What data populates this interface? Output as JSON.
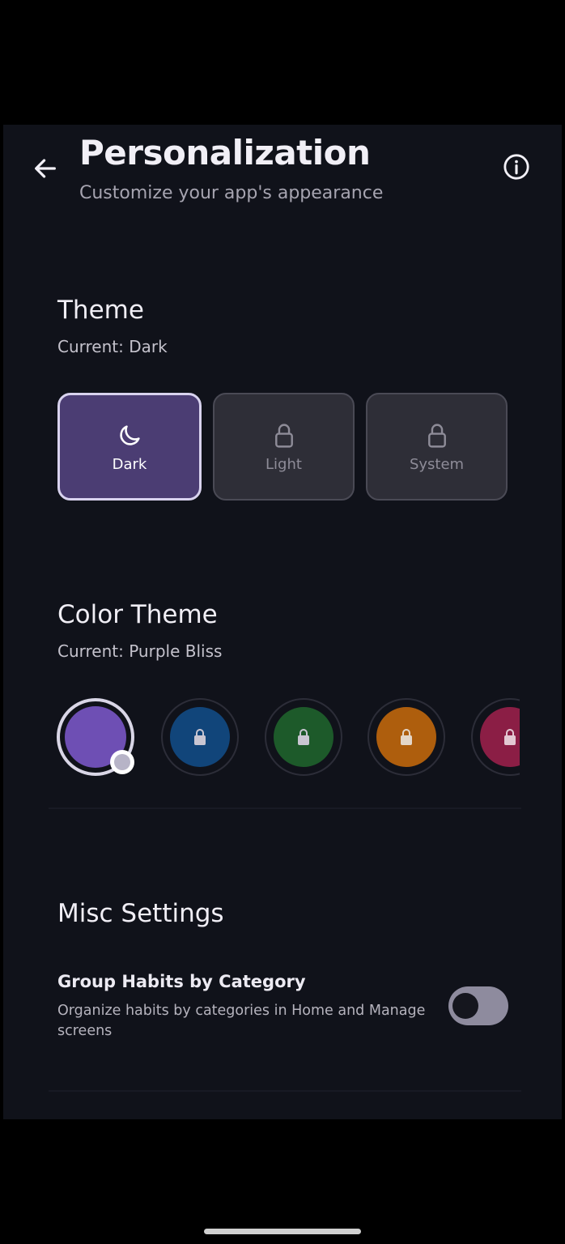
{
  "header": {
    "title": "Personalization",
    "subtitle": "Customize your app's appearance"
  },
  "icons": {
    "back": "arrow-left-icon",
    "info": "info-icon",
    "dark": "moon-icon",
    "locked": "lock-icon"
  },
  "theme": {
    "title": "Theme",
    "current": "Current: Dark",
    "options": [
      {
        "label": "Dark",
        "selected": true,
        "locked": false
      },
      {
        "label": "Light",
        "selected": false,
        "locked": true
      },
      {
        "label": "System",
        "selected": false,
        "locked": true
      }
    ]
  },
  "color_theme": {
    "title": "Color Theme",
    "current": "Current: Purple Bliss",
    "swatches": [
      {
        "color": "#6e4fb4",
        "selected": true,
        "locked": false
      },
      {
        "color": "#11457a",
        "selected": false,
        "locked": true
      },
      {
        "color": "#1d5a2a",
        "selected": false,
        "locked": true
      },
      {
        "color": "#ae5e0d",
        "selected": false,
        "locked": true
      },
      {
        "color": "#8b1e45",
        "selected": false,
        "locked": true
      }
    ]
  },
  "misc": {
    "title": "Misc Settings",
    "group_habits": {
      "label": "Group Habits by Category",
      "description": "Organize habits by categories in Home and Manage screens",
      "enabled": false
    }
  }
}
